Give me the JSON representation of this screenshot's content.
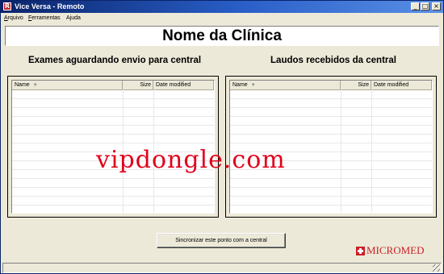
{
  "window": {
    "title": "Vice Versa - Remoto",
    "app_icon_letter": "R"
  },
  "title_buttons": {
    "minimize": "_",
    "maximize": "□",
    "close": "×"
  },
  "menu": [
    {
      "label": "Arquivo",
      "accel": "A",
      "rest": "rquivo"
    },
    {
      "label": "Ferramentas",
      "accel": "F",
      "rest": "erramentas"
    },
    {
      "label": "Ajuda",
      "accel": "",
      "rest": "Ajuda"
    }
  ],
  "clinic": {
    "name": "Nome da Clínica"
  },
  "left_panel": {
    "title": "Exames aguardando envio para central",
    "columns": [
      "Name",
      "Size",
      "Date modified"
    ]
  },
  "right_panel": {
    "title": "Laudos recebidos da central",
    "columns": [
      "Name",
      "Size",
      "Date modified"
    ]
  },
  "sync_button": {
    "label": "Sincronizar este ponto com a central"
  },
  "logo": {
    "text": "MICROMED"
  },
  "watermark": {
    "text": "vipdongle.com"
  },
  "colors": {
    "titlebar": "#0a246a",
    "logo_red": "#c8202a",
    "watermark_red": "#e0001a",
    "face": "#ece9d8"
  },
  "icons": [
    "app-icon",
    "sort-desc-icon",
    "micromed-cross-icon",
    "size-grip-icon"
  ]
}
